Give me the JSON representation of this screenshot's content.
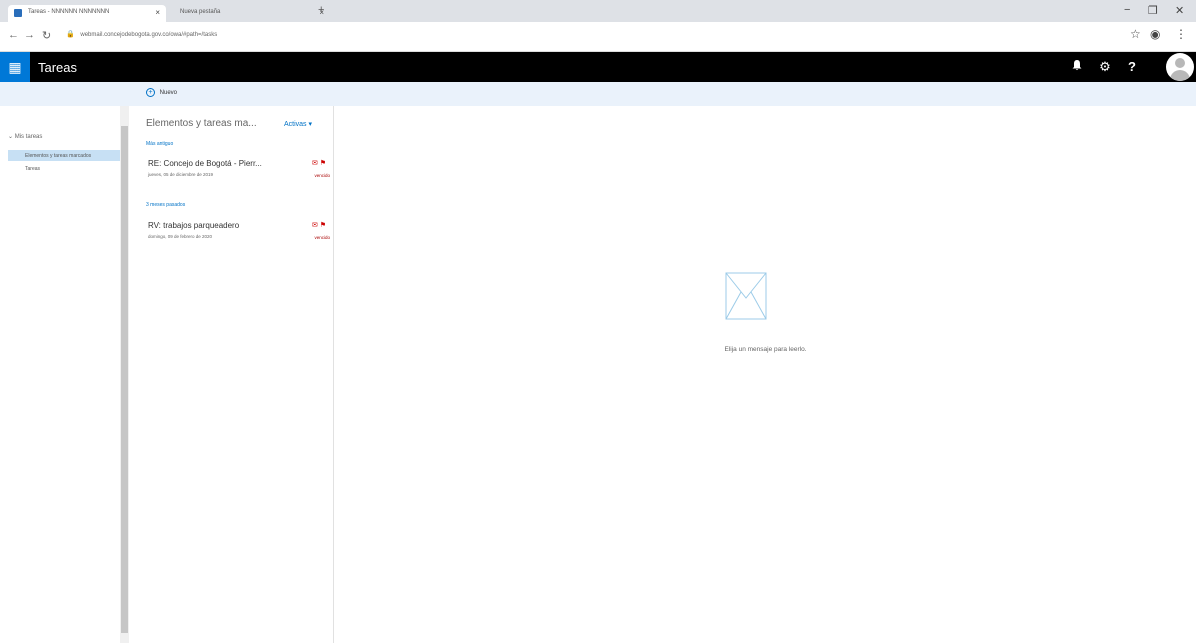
{
  "browser": {
    "active_tab_title": "Tareas - NNNNNN NNNNNNN",
    "inactive_tab_title": "Nueva pestaña",
    "url": "webmail.concejodebogota.gov.co/owa/#path=/tasks",
    "new_tab_glyph": "+",
    "win_controls": [
      "−",
      "❐",
      "✕"
    ]
  },
  "suite_bar": {
    "waffle_glyph": "▦",
    "app_title": "Tareas",
    "icons": {
      "bell": "🔔",
      "gear": "⚙",
      "help": "?"
    }
  },
  "command_bar": {
    "new_label": "Nuevo",
    "new_glyph": "+"
  },
  "left_nav": {
    "header": "Mis tareas",
    "items": [
      {
        "label": "Elementos y tareas marcados",
        "selected": true
      },
      {
        "label": "Tareas",
        "selected": false
      }
    ]
  },
  "message_list": {
    "title": "Elementos y tareas ma...",
    "filter_label": "Activas ▾",
    "groups": [
      {
        "header": "Más antiguo",
        "items": [
          {
            "subject": "RE: Concejo de Bogotá - Pierr...",
            "date": "jueves, 05 de diciembre de 2019",
            "due": "vencido"
          }
        ]
      },
      {
        "header": "3 meses pasados",
        "items": [
          {
            "subject": "RV: trabajos parqueadero",
            "date": "domingo, 09 de febrero de 2020",
            "due": "vencido"
          }
        ]
      }
    ]
  },
  "reading_pane": {
    "empty_text": "Elija un mensaje para leerlo."
  },
  "colors": {
    "suite_bar": "#000000",
    "waffle": "#0078d7",
    "accent": "#0072c6",
    "selected_nav": "#c7e0f4",
    "overdue": "#a80000"
  }
}
